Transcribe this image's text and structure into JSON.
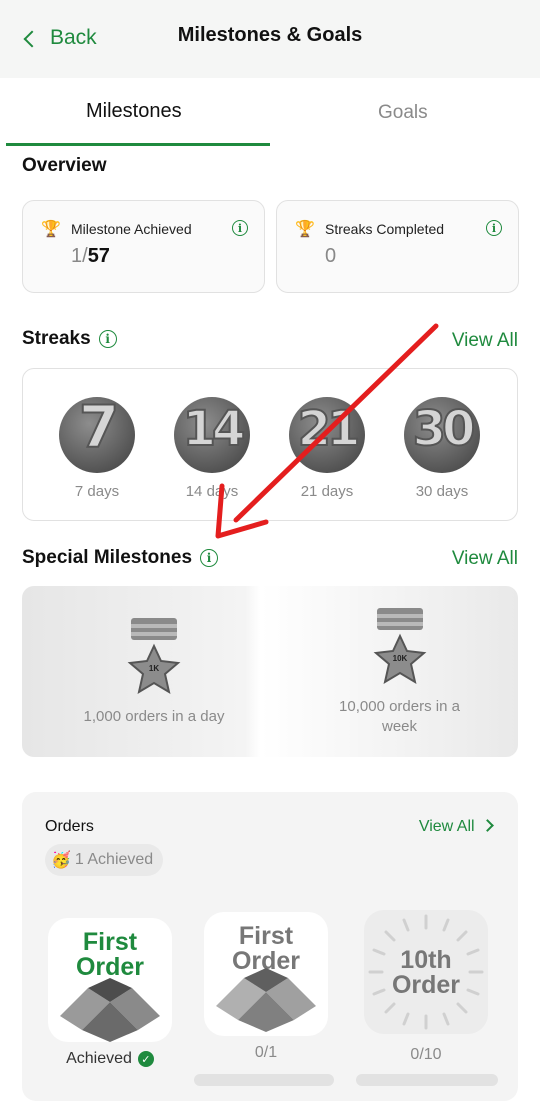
{
  "header": {
    "back_label": "Back",
    "title": "Milestones & Goals"
  },
  "tabs": [
    {
      "label": "Milestones",
      "active": true
    },
    {
      "label": "Goals",
      "active": false
    }
  ],
  "overview": {
    "title": "Overview",
    "cards": [
      {
        "label": "Milestone Achieved",
        "value_achieved": "1",
        "value_sep": "/",
        "value_total": "57",
        "icon": "trophy-icon"
      },
      {
        "label": "Streaks Completed",
        "value": "0",
        "icon": "trophy-icon"
      }
    ]
  },
  "streaks": {
    "title": "Streaks",
    "view_all": "View All",
    "items": [
      {
        "number": "7",
        "label": "7 days"
      },
      {
        "number": "14",
        "label": "14 days"
      },
      {
        "number": "21",
        "label": "21 days"
      },
      {
        "number": "30",
        "label": "30 days"
      }
    ]
  },
  "special_milestones": {
    "title": "Special Milestones",
    "view_all": "View All",
    "items": [
      {
        "badge_text": "1K",
        "label": "1,000 orders in a day"
      },
      {
        "badge_text": "10K",
        "label": "10,000 orders in a week"
      }
    ]
  },
  "orders": {
    "title": "Orders",
    "view_all": "View All",
    "achieved_badge": "1 Achieved",
    "items": [
      {
        "tile_text": "First Order",
        "status": "Achieved",
        "color": "#1f8a3e"
      },
      {
        "tile_text": "First Order",
        "status": "0/1",
        "color": "#777777"
      },
      {
        "tile_text": "10th Order",
        "status": "0/10",
        "color": "#777777"
      }
    ]
  },
  "colors": {
    "accent": "#1f8a3e",
    "annotation_arrow": "#e41e1e"
  }
}
